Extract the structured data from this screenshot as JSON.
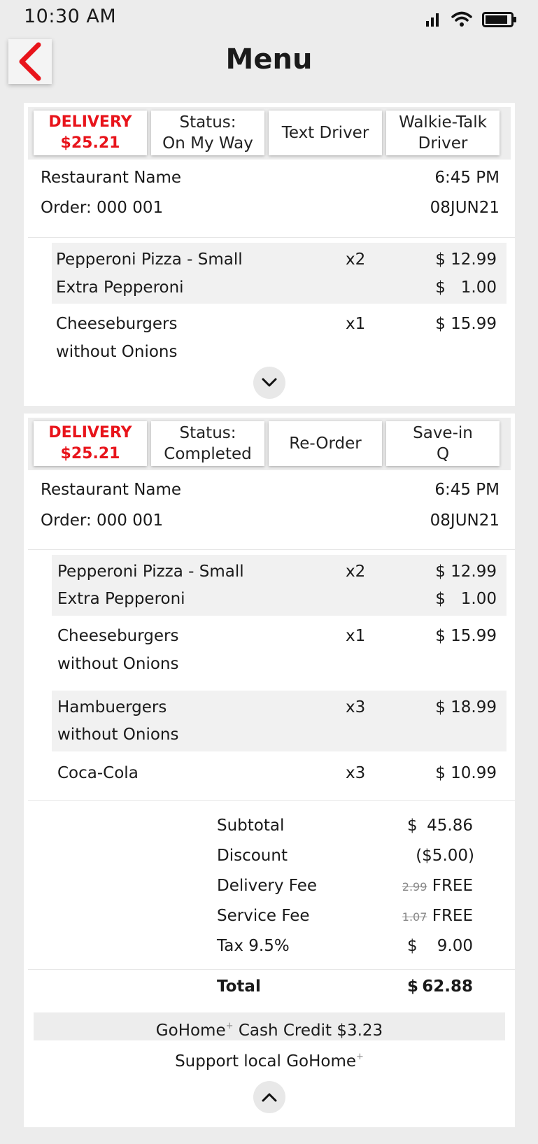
{
  "status_bar": {
    "time": "10:30 AM",
    "icons": [
      "signal-icon",
      "wifi-icon",
      "battery-icon"
    ]
  },
  "header": {
    "title": "Menu",
    "back_icon": "chevron-left-icon"
  },
  "colors": {
    "accent": "#e8141b",
    "background": "#ececec",
    "card": "#ffffff",
    "shaded_row": "#f1f1f1"
  },
  "orders": [
    {
      "buttons": {
        "delivery_label": "DELIVERY",
        "delivery_amount": "$25.21",
        "status_label": "Status:",
        "status_value": "On My Way",
        "action1_line1": "Text Driver",
        "action2_line1": "Walkie-Talk",
        "action2_line2": "Driver"
      },
      "restaurant": "Restaurant Name",
      "time": "6:45 PM",
      "order_number": "Order: 000 001",
      "date": "08JUN21",
      "items": [
        {
          "name": "Pepperoni Pizza - Small",
          "sub": "Extra Pepperoni",
          "qty": "x2",
          "price": "$ 12.99",
          "sub_price": "$   1.00"
        },
        {
          "name": "Cheeseburgers",
          "sub": "without Onions",
          "qty": "x1",
          "price": "$ 15.99"
        }
      ],
      "toggle_icon": "chevron-down-icon"
    },
    {
      "buttons": {
        "delivery_label": "DELIVERY",
        "delivery_amount": "$25.21",
        "status_label": "Status:",
        "status_value": "Completed",
        "action1_line1": "Re-Order",
        "action2_line1": "Save-in",
        "action2_line2": "Q"
      },
      "restaurant": "Restaurant Name",
      "time": "6:45 PM",
      "order_number": "Order: 000 001",
      "date": "08JUN21",
      "items": [
        {
          "name": "Pepperoni Pizza - Small",
          "sub": "Extra Pepperoni",
          "qty": "x2",
          "price": "$ 12.99",
          "sub_price": "$   1.00"
        },
        {
          "name": "Cheeseburgers",
          "sub": "without Onions",
          "qty": "x1",
          "price": "$ 15.99"
        },
        {
          "name": "Hambuergers",
          "sub": "without Onions",
          "qty": "x3",
          "price": "$ 18.99"
        },
        {
          "name": "Coca-Cola",
          "qty": "x3",
          "price": "$ 10.99"
        }
      ],
      "summary": {
        "subtotal_label": "Subtotal",
        "subtotal_cur": "$",
        "subtotal_value": "45.86",
        "discount_label": "Discount",
        "discount_value": "($5.00)",
        "delivery_fee_label": "Delivery Fee",
        "delivery_fee_old": "2.99",
        "delivery_fee_value": "FREE",
        "service_fee_label": "Service Fee",
        "service_fee_old": "1.07",
        "service_fee_value": "FREE",
        "tax_label": "Tax 9.5%",
        "tax_cur": "$",
        "tax_value": "9.00",
        "total_label": "Total",
        "total_cur": "$",
        "total_value": "62.88"
      },
      "credit_brand": "GoHome",
      "credit_text": "Cash Credit $3.23",
      "support_text": "Support local GoHome",
      "superscript": "+",
      "toggle_icon": "chevron-up-icon"
    }
  ]
}
